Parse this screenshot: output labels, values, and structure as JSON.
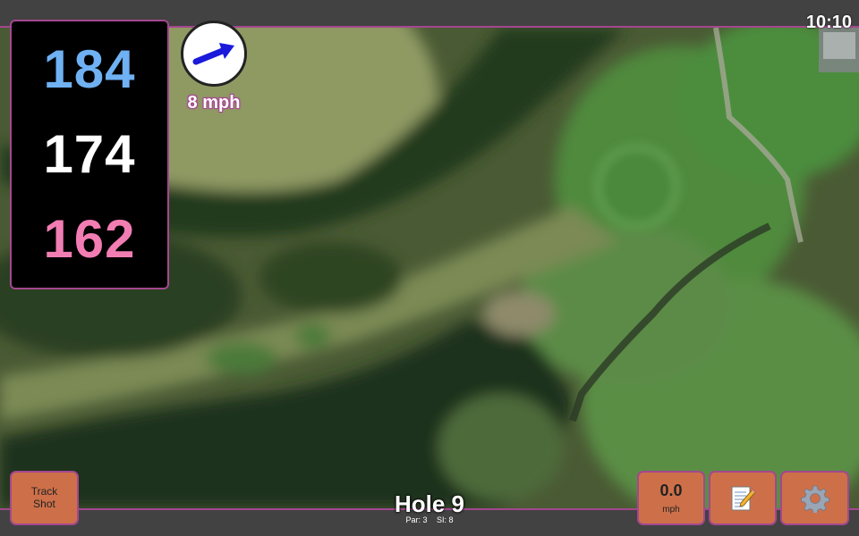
{
  "status": {
    "time": "10:10"
  },
  "yardage": {
    "back": "184",
    "middle": "174",
    "front": "162"
  },
  "wind": {
    "speed": "8 mph",
    "icon": "wind-direction-arrow-icon"
  },
  "hole": {
    "title": "Hole 9",
    "par": "Par: 3",
    "stroke_index": "SI: 8"
  },
  "buttons": {
    "track_shot": {
      "line1": "Track",
      "line2": "Shot"
    },
    "speed": {
      "value": "0.0",
      "unit": "mph"
    },
    "notes": {
      "icon": "notepad-icon"
    },
    "settings": {
      "icon": "gear-icon"
    }
  },
  "colors": {
    "accent": "#a4478f",
    "button": "#cd7049",
    "back_yardage": "#6fb1f2",
    "middle_yardage": "#ffffff",
    "front_yardage": "#f27db3",
    "wind_arrow": "#1a1adb"
  }
}
